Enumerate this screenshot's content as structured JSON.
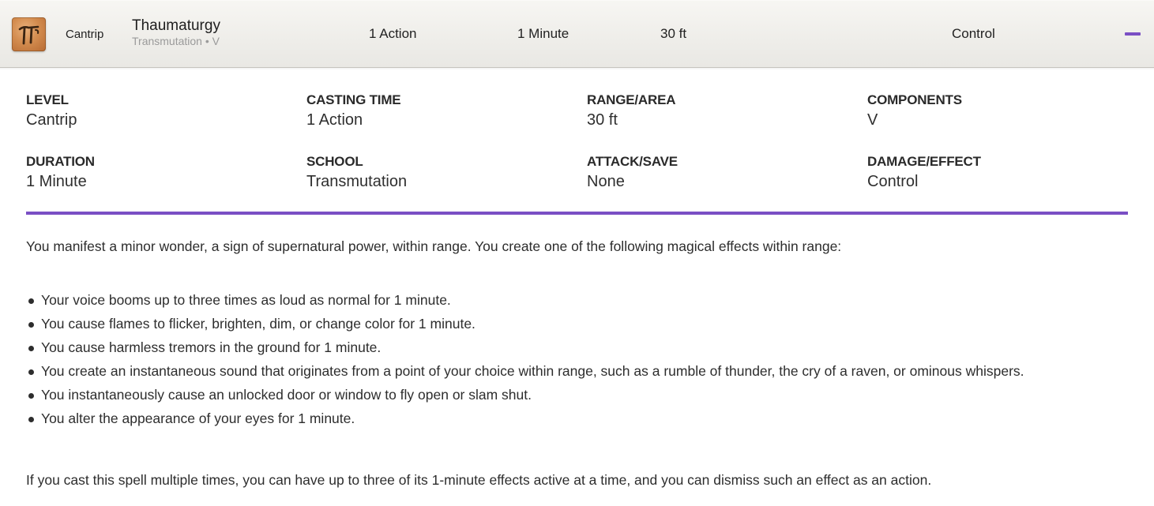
{
  "header": {
    "icon": "pi-rune-icon",
    "level": "Cantrip",
    "name": "Thaumaturgy",
    "subtitle": "Transmutation • V",
    "casting_time": "1 Action",
    "duration": "1 Minute",
    "range": "30 ft",
    "effect": "Control",
    "accent_color": "#7a4fc4"
  },
  "stats": [
    {
      "label": "LEVEL",
      "value": "Cantrip"
    },
    {
      "label": "CASTING TIME",
      "value": "1 Action"
    },
    {
      "label": "RANGE/AREA",
      "value": "30 ft"
    },
    {
      "label": "COMPONENTS",
      "value": "V"
    },
    {
      "label": "DURATION",
      "value": "1 Minute"
    },
    {
      "label": "SCHOOL",
      "value": "Transmutation"
    },
    {
      "label": "ATTACK/SAVE",
      "value": "None"
    },
    {
      "label": "DAMAGE/EFFECT",
      "value": "Control"
    }
  ],
  "description": {
    "intro": "You manifest a minor wonder, a sign of supernatural power, within range. You create one of the following magical effects within range:",
    "effects": [
      "Your voice booms up to three times as loud as normal for 1 minute.",
      "You cause flames to flicker, brighten, dim, or change color for 1 minute.",
      "You cause harmless tremors in the ground for 1 minute.",
      "You create an instantaneous sound that originates from a point of your choice within range, such as a rumble of thunder, the cry of a raven, or ominous whispers.",
      "You instantaneously cause an unlocked door or window to fly open or slam shut.",
      "You alter the appearance of your eyes for 1 minute."
    ],
    "outro": "If you cast this spell multiple times, you can have up to three of its 1-minute effects active at a time, and you can dismiss such an effect as an action."
  }
}
